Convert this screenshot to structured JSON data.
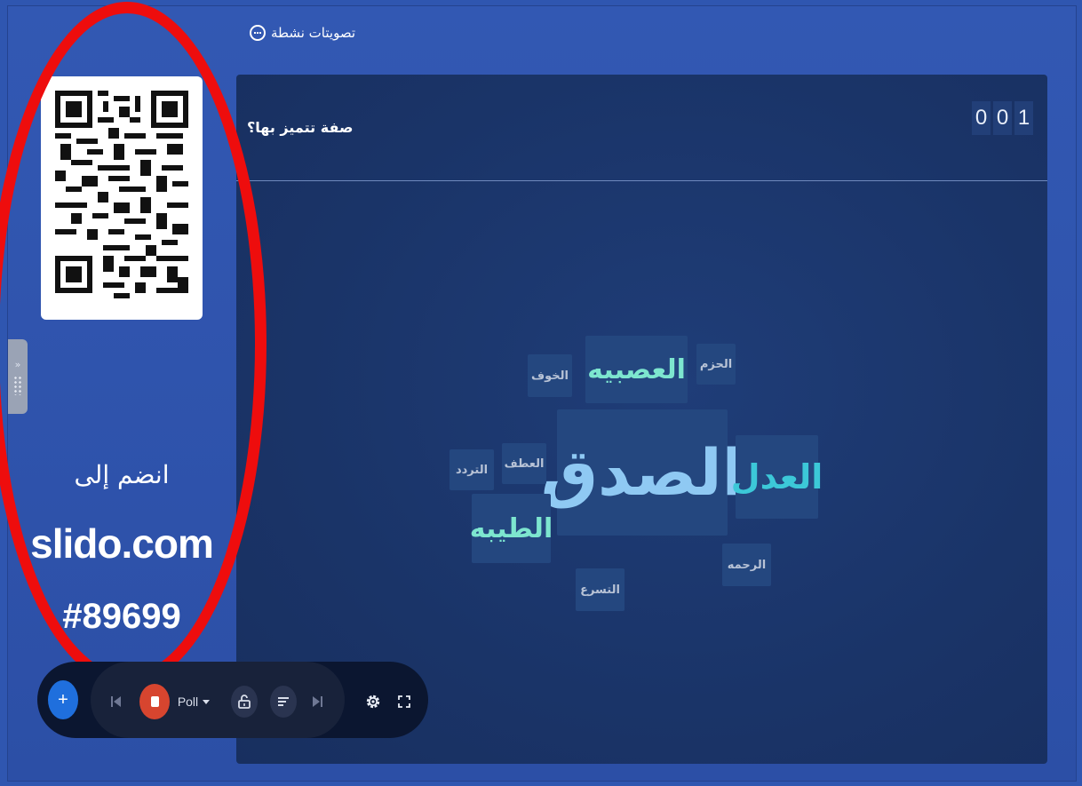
{
  "header": {
    "active_polls_label": "تصويتات نشطة"
  },
  "join": {
    "label": "انضم إلى",
    "site": "slido.com",
    "code": "#89699"
  },
  "poll": {
    "question": "صفة تتميز بها؟",
    "response_count_digits": [
      "0",
      "0",
      "1"
    ]
  },
  "word_cloud": {
    "words": [
      {
        "text": "الصدق",
        "color": "#8fc9f3",
        "weight": 1.0
      },
      {
        "text": "العدل",
        "color": "#3cc8d8",
        "weight": 0.6
      },
      {
        "text": "العصبيه",
        "color": "#7de6cf",
        "weight": 0.55
      },
      {
        "text": "الطيبه",
        "color": "#7de6cf",
        "weight": 0.55
      },
      {
        "text": "الحزم",
        "color": "#b8c3d6",
        "weight": 0.2
      },
      {
        "text": "الخوف",
        "color": "#b8c3d6",
        "weight": 0.2
      },
      {
        "text": "العطف",
        "color": "#b8c3d6",
        "weight": 0.2
      },
      {
        "text": "التردد",
        "color": "#b8c3d6",
        "weight": 0.2
      },
      {
        "text": "الرحمه",
        "color": "#b8c3d6",
        "weight": 0.2
      },
      {
        "text": "التسرع",
        "color": "#b8c3d6",
        "weight": 0.2
      }
    ]
  },
  "toolbar": {
    "add_icon": "+",
    "poll_dropdown_label": "Poll",
    "icons": [
      "plus-icon",
      "skip-previous-icon",
      "stop-icon",
      "chevron-down-icon",
      "unlock-icon",
      "sort-icon",
      "skip-next-icon",
      "settings-icon",
      "fullscreen-icon"
    ]
  },
  "colors": {
    "background": "#2f56b0",
    "panel": "#1a3468",
    "accent_red": "#ee0d0d",
    "add_button": "#1f6fdd",
    "stop_button": "#d7452f"
  }
}
